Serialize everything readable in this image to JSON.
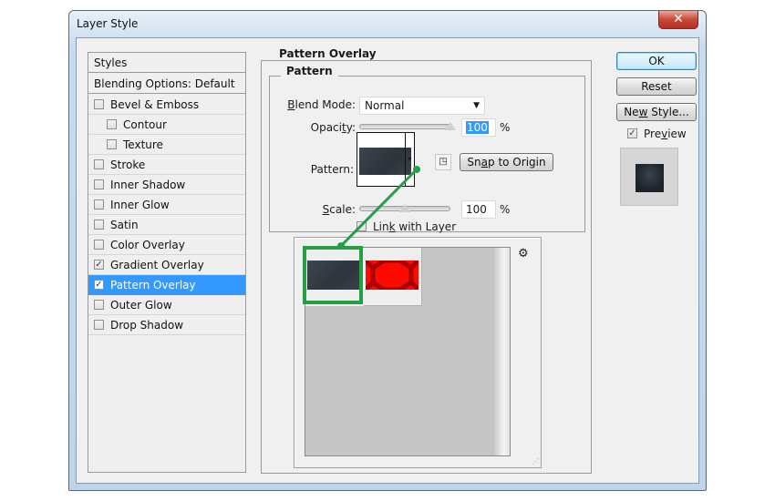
{
  "window": {
    "title": "Layer Style",
    "close_glyph": "✕"
  },
  "styles_panel": {
    "header": "Styles",
    "blending_options": "Blending Options: Default",
    "items": [
      {
        "label": "Bevel & Emboss",
        "checked": false,
        "indent": false,
        "selected": false
      },
      {
        "label": "Contour",
        "checked": false,
        "indent": true,
        "selected": false
      },
      {
        "label": "Texture",
        "checked": false,
        "indent": true,
        "selected": false
      },
      {
        "label": "Stroke",
        "checked": false,
        "indent": false,
        "selected": false
      },
      {
        "label": "Inner Shadow",
        "checked": false,
        "indent": false,
        "selected": false
      },
      {
        "label": "Inner Glow",
        "checked": false,
        "indent": false,
        "selected": false
      },
      {
        "label": "Satin",
        "checked": false,
        "indent": false,
        "selected": false
      },
      {
        "label": "Color Overlay",
        "checked": false,
        "indent": false,
        "selected": false
      },
      {
        "label": "Gradient Overlay",
        "checked": true,
        "indent": false,
        "selected": false
      },
      {
        "label": "Pattern Overlay",
        "checked": true,
        "indent": false,
        "selected": true
      },
      {
        "label": "Outer Glow",
        "checked": false,
        "indent": false,
        "selected": false
      },
      {
        "label": "Drop Shadow",
        "checked": false,
        "indent": false,
        "selected": false
      }
    ]
  },
  "pattern_overlay": {
    "section_title": "Pattern Overlay",
    "group_title": "Pattern",
    "blend_mode": {
      "label_u": "B",
      "label_rest": "lend Mode:",
      "value": "Normal",
      "arrow": "▼"
    },
    "opacity": {
      "label_pre": "Opaci",
      "label_u": "t",
      "label_post": "y:",
      "value": "100",
      "fraction": 1.0,
      "unit": "%"
    },
    "pattern": {
      "label": "Pattern:",
      "arrow": "▾",
      "new_preset_glyph": "◳"
    },
    "snap_button": {
      "pre": "Sn",
      "u": "a",
      "post": "p to Origin"
    },
    "scale": {
      "label_u": "S",
      "label_rest": "cale:",
      "value": "100",
      "fraction": 0.5,
      "unit": "%"
    },
    "link": {
      "pre": "Lin",
      "u": "k",
      "post": " with Layer",
      "checked": true
    }
  },
  "picker": {
    "gear_glyph": "⚙",
    "grip_glyph": "⋰",
    "swatches": [
      {
        "name": "dark-slate-pattern",
        "color": "#353b44",
        "selected": true
      },
      {
        "name": "red-hexagon-pattern",
        "color": "#ff0a00",
        "selected": false
      }
    ]
  },
  "buttons": {
    "ok": "OK",
    "reset": "Reset",
    "new_style": {
      "pre": "Ne",
      "u": "w",
      "post": " Style..."
    },
    "preview": {
      "pre": "Pre",
      "u": "v",
      "post": "iew",
      "checked": true
    }
  },
  "colors": {
    "selection": "#3399ff",
    "highlight_annotation": "#23a043"
  }
}
